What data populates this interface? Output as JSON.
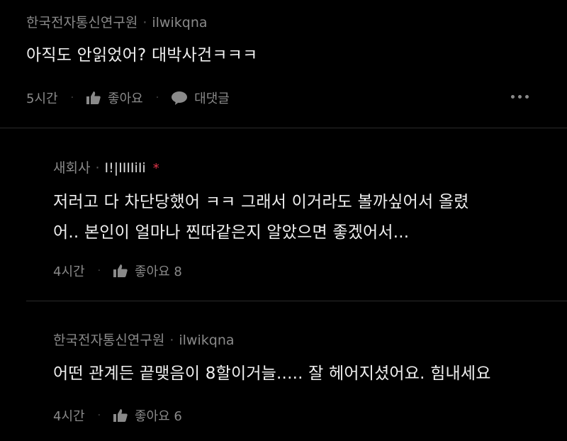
{
  "comments": [
    {
      "author": "한국전자통신연구원",
      "handle": "ilwikqna",
      "text_lines": [
        "아직도 안읽었어? 대박사건ㅋㅋㅋ"
      ],
      "time": "5시간",
      "like_label": "좋아요",
      "reply_label": "대댓글"
    },
    {
      "author": "새회사",
      "handle": "I!|IIIIiIi",
      "text_lines": [
        "저러고 다 차단당했어 ㅋㅋ 그래서 이거라도 볼까싶어서 올렸",
        "어.. 본인이 얼마나 찐따같은지 알았으면 좋겠어서..."
      ],
      "time": "4시간",
      "like_label": "좋아요 8",
      "star": "*"
    },
    {
      "author": "한국전자통신연구원",
      "handle": "ilwikqna",
      "text_lines": [
        "어떤 관계든 끝맺음이 8할이거늘..... 잘 헤어지셨어요. 힘내세요"
      ],
      "time": "4시간",
      "like_label": "좋아요 6"
    }
  ],
  "colors": {
    "background": "#000000",
    "text": "#efefef",
    "meta": "#8a8a8a",
    "star": "#e0364a"
  },
  "icons": {
    "like": "thumbs-up-icon",
    "reply": "speech-bubble-icon",
    "more": "more-dots-icon"
  }
}
